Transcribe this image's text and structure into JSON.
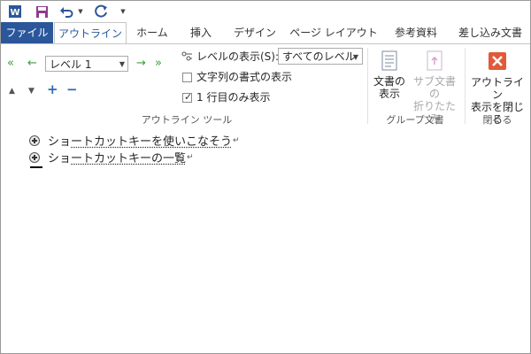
{
  "quick_access": {
    "word_icon": "word-app-icon",
    "save_icon": "save-icon",
    "undo_icon": "undo-icon",
    "redo_icon": "repeat-icon",
    "customize_icon": "chevron-down-icon"
  },
  "tabs": [
    {
      "label": "ファイル"
    },
    {
      "label": "アウトライン"
    },
    {
      "label": "ホーム"
    },
    {
      "label": "挿入"
    },
    {
      "label": "デザイン"
    },
    {
      "label": "ページ レイアウト"
    },
    {
      "label": "参考資料"
    },
    {
      "label": "差し込み文書"
    }
  ],
  "outline_tools": {
    "level_value": "レベル 1",
    "show_level_label": "レベルの表示(S):",
    "show_level_value": "すべてのレベル",
    "show_formatting_label": "文字列の書式の表示",
    "show_formatting_checked": false,
    "first_line_only_label": "1 行目のみ表示",
    "first_line_only_checked": true,
    "group_label": "アウトライン ツール"
  },
  "master_document": {
    "show_document_label_1": "文書の",
    "show_document_label_2": "表示",
    "collapse_subdocs_label_1": "サブ文書の",
    "collapse_subdocs_label_2": "折りたたみ",
    "group_label": "グループ文書"
  },
  "close_group": {
    "close_label_1": "アウトライン",
    "close_label_2": "表示を閉じる",
    "group_label": "閉じる"
  },
  "document": {
    "headings": [
      {
        "prefix": "ショ",
        "underlined": "ートカットキーを使いこなそう"
      },
      {
        "prefix": "ショ",
        "underlined": "ートカットキーの一覧"
      }
    ],
    "paragraph_mark": "↵"
  },
  "colors": {
    "file_tab": "#2b579a",
    "accent": "#2b579a",
    "promote_demote": "#3c9e3c",
    "close_button": "#e05a3a"
  }
}
